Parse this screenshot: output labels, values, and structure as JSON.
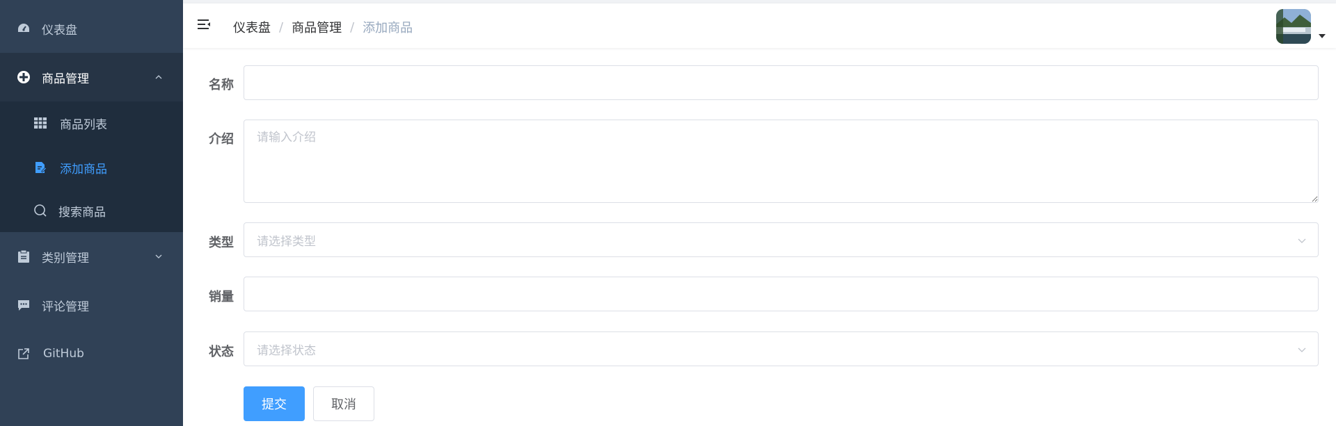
{
  "sidebar": {
    "items": [
      {
        "label": "仪表盘",
        "icon": "dashboard-icon"
      },
      {
        "label": "商品管理",
        "icon": "product-icon"
      },
      {
        "label": "类别管理",
        "icon": "clipboard-icon"
      },
      {
        "label": "评论管理",
        "icon": "comment-icon"
      },
      {
        "label": "GitHub",
        "icon": "external-link-icon"
      }
    ],
    "submenu": [
      {
        "label": "商品列表",
        "icon": "table-icon"
      },
      {
        "label": "添加商品",
        "icon": "edit-doc-icon"
      },
      {
        "label": "搜索商品",
        "icon": "search-icon"
      }
    ]
  },
  "breadcrumb": [
    "仪表盘",
    "商品管理",
    "添加商品"
  ],
  "breadcrumb_sep": "/",
  "form": {
    "name_label": "名称",
    "name_value": "",
    "intro_label": "介绍",
    "intro_placeholder": "请输入介绍",
    "type_label": "类型",
    "type_placeholder": "请选择类型",
    "sales_label": "销量",
    "sales_value": "",
    "status_label": "状态",
    "status_placeholder": "请选择状态",
    "submit_label": "提交",
    "cancel_label": "取消"
  },
  "colors": {
    "sidebar_bg": "#304156",
    "submenu_bg": "#1f2d3d",
    "accent": "#409eff",
    "sidebar_text": "#bfcbd9"
  }
}
